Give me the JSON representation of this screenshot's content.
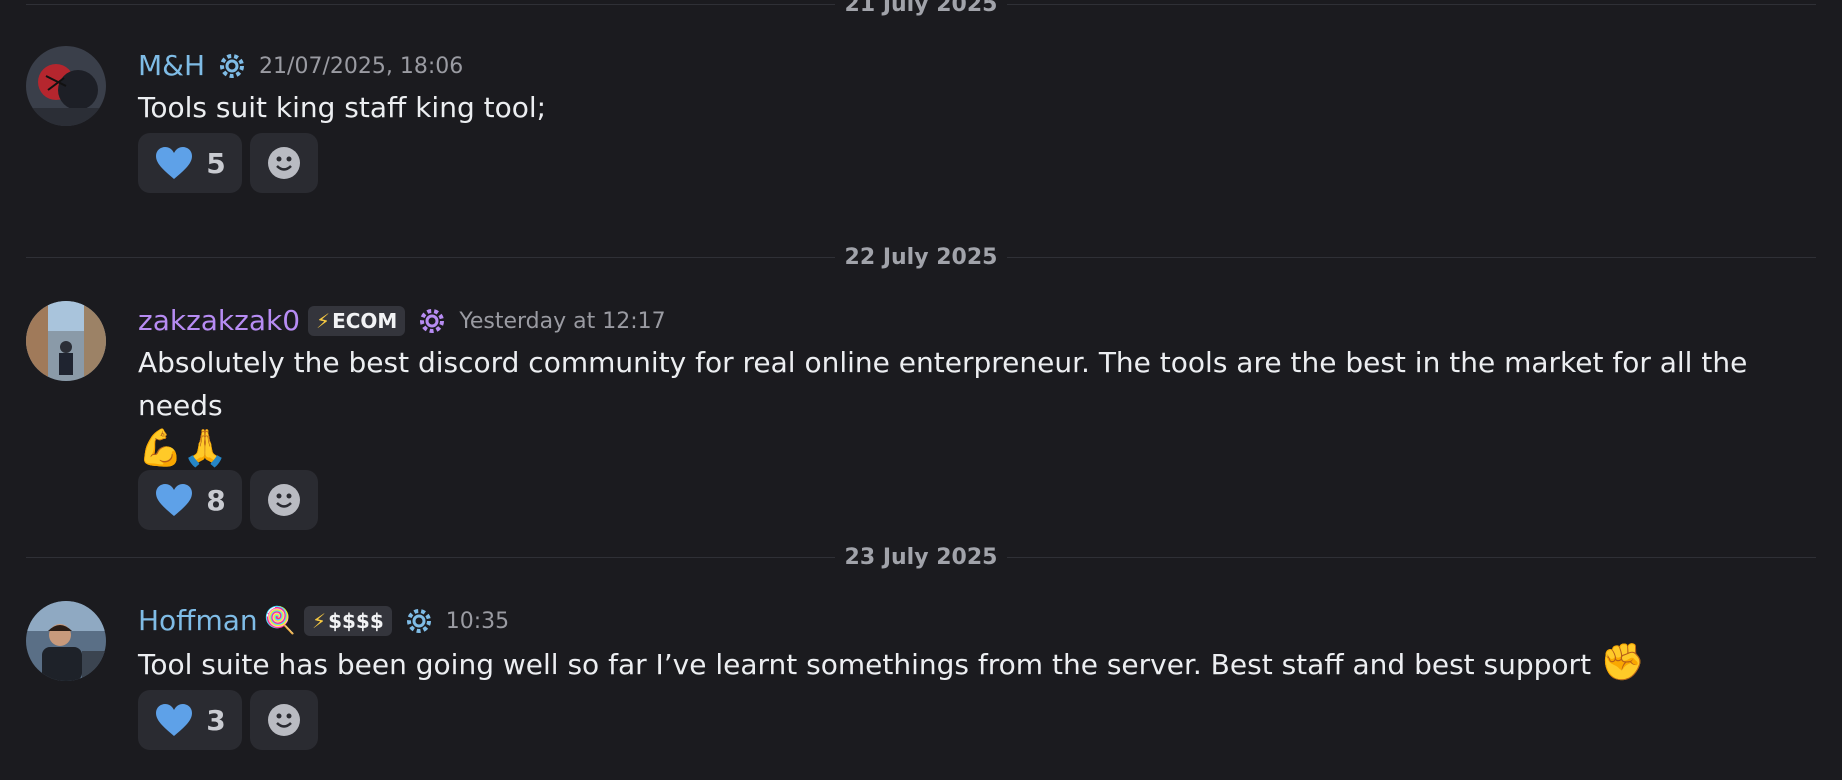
{
  "dividers": [
    "21 July 2025",
    "22 July 2025",
    "23 July 2025"
  ],
  "messages": [
    {
      "username": "M&H",
      "timestamp": "21/07/2025, 18:06",
      "text": "Tools suit king staff king tool;",
      "reaction": {
        "emoji": "blue-heart",
        "count": "5"
      },
      "username_color": "#7fbce6"
    },
    {
      "username": "zakzakzak0",
      "tag": "ECOM",
      "timestamp": "Yesterday at 12:17",
      "text": "Absolutely the best discord community for real online enterpreneur. The tools are the best in the market for all the needs",
      "text_emoji": "💪🙏",
      "reaction": {
        "emoji": "blue-heart",
        "count": "8"
      },
      "username_color": "#b78cf3"
    },
    {
      "username": "Hoffman",
      "username_emoji": "🍭",
      "tag": "$$$$",
      "timestamp": "10:35",
      "text": "Tool suite has been going well so far I’ve learnt somethings from the server. Best staff and best support",
      "text_emoji": "✊",
      "reaction": {
        "emoji": "blue-heart",
        "count": "3"
      },
      "username_color": "#7fbce6"
    }
  ],
  "colors": {
    "background": "#1b1b1f",
    "reaction_bg": "#2a2b31",
    "heart": "#5ea1e8"
  }
}
